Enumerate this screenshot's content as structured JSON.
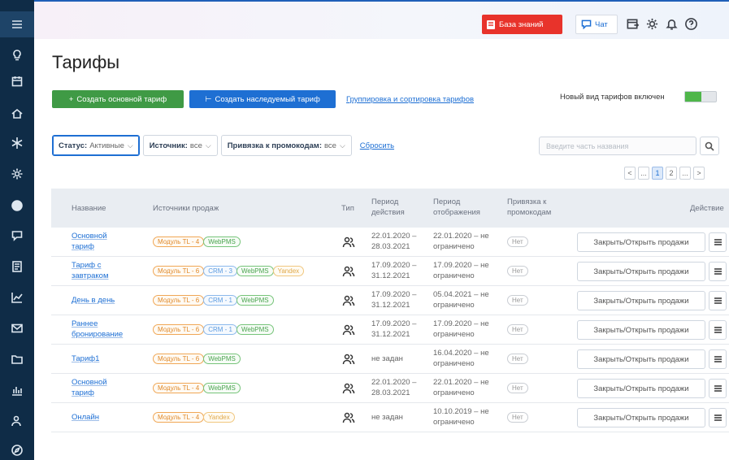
{
  "topbar": {
    "knowledge_base": "База знаний",
    "chat": "Чат"
  },
  "page": {
    "title": "Тарифы",
    "create_main": "Создать основной тариф",
    "create_inherited": "Создать наследуемый тариф",
    "grouping_link": "Группировка и сортировка тарифов",
    "new_view_label": "Новый вид тарифов включен",
    "new_view_enabled": true
  },
  "filters": {
    "status_label": "Статус:",
    "status_value": "Активные",
    "source_label": "Источник:",
    "source_value": "все",
    "promo_label": "Привязка к промокодам:",
    "promo_value": "все",
    "reset": "Сбросить",
    "search_placeholder": "Введите часть названия"
  },
  "pager": {
    "prev": "<",
    "gap1": "...",
    "page1": "1",
    "page2": "2",
    "gap2": "...",
    "next": ">"
  },
  "table": {
    "headers": {
      "name": "Название",
      "sources": "Источники продаж",
      "type": "Тип",
      "period_action_1": "Период",
      "period_action_2": "действия",
      "period_display_1": "Период",
      "period_display_2": "отображения",
      "promo_1": "Привязка к",
      "promo_2": "промокодам",
      "actions": "Действие"
    },
    "action_label": "Закрыть/Открыть продажи",
    "rows": [
      {
        "name1": "Основной",
        "name2": "тариф",
        "t1": "Модуль TL - 4",
        "t2": "WebPMS",
        "t3": "",
        "t4": "",
        "pa1": "22.01.2020 –",
        "pa2": "28.03.2021",
        "pd1": "22.01.2020 – не",
        "pd2": "ограничено",
        "promo": "Нет"
      },
      {
        "name1": "Тариф с",
        "name2": "завтраком",
        "t1": "Модуль TL - 6",
        "t2": "CRM - 3",
        "t3": "WebPMS",
        "t4": "Yandex",
        "pa1": "17.09.2020 –",
        "pa2": "31.12.2021",
        "pd1": "17.09.2020 – не",
        "pd2": "ограничено",
        "promo": "Нет"
      },
      {
        "name1": "День в день",
        "name2": "",
        "t1": "Модуль TL - 6",
        "t2": "CRM - 1",
        "t3": "WebPMS",
        "t4": "",
        "pa1": "17.09.2020 –",
        "pa2": "31.12.2021",
        "pd1": "05.04.2021 – не",
        "pd2": "ограничено",
        "promo": "Нет"
      },
      {
        "name1": "Раннее",
        "name2": "бронирование",
        "t1": "Модуль TL - 6",
        "t2": "CRM - 1",
        "t3": "WebPMS",
        "t4": "",
        "pa1": "17.09.2020 –",
        "pa2": "31.12.2021",
        "pd1": "17.09.2020 – не",
        "pd2": "ограничено",
        "promo": "Нет"
      },
      {
        "name1": "Тариф1",
        "name2": "",
        "t1": "Модуль TL - 6",
        "t2": "WebPMS",
        "t3": "",
        "t4": "",
        "pa1": "не задан",
        "pa2": "",
        "pd1": "16.04.2020 – не",
        "pd2": "ограничено",
        "promo": "Нет"
      },
      {
        "name1": "Основной",
        "name2": "тариф",
        "t1": "Модуль TL - 4",
        "t2": "WebPMS",
        "t3": "",
        "t4": "",
        "pa1": "22.01.2020 –",
        "pa2": "28.03.2021",
        "pd1": "22.01.2020 – не",
        "pd2": "ограничено",
        "promo": "Нет"
      },
      {
        "name1": "Онлайн",
        "name2": "",
        "t1": "Модуль TL - 4",
        "t2": "Yandex",
        "t3": "",
        "t4": "",
        "pa1": "не задан",
        "pa2": "",
        "pd1": "10.10.2019 – не",
        "pd2": "ограничено",
        "promo": "Нет"
      }
    ]
  }
}
